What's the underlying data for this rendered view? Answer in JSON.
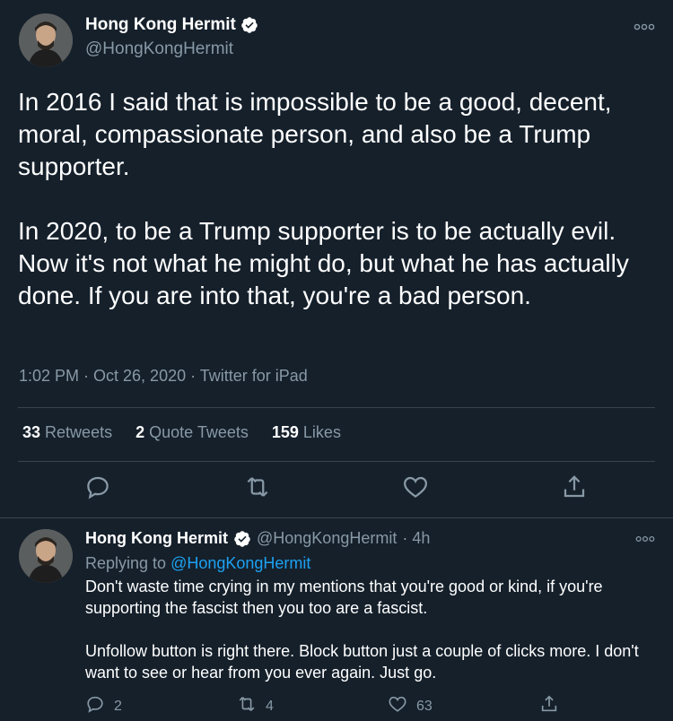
{
  "main_tweet": {
    "display_name": "Hong Kong Hermit",
    "handle": "@HongKongHermit",
    "text": "In 2016 I said that is impossible to be a good, decent, moral, compassionate person, and also be a Trump supporter.\n\nIn 2020, to be a Trump supporter is to be actually evil. Now it's not what he might do, but what he has actually done. If you are into that, you're a bad person.",
    "meta": "1:02 PM · Oct 26, 2020 · Twitter for iPad",
    "stats": {
      "retweets_count": "33",
      "retweets_label": "Retweets",
      "quotes_count": "2",
      "quotes_label": "Quote Tweets",
      "likes_count": "159",
      "likes_label": "Likes"
    }
  },
  "reply_tweet": {
    "display_name": "Hong Kong Hermit",
    "handle": "@HongKongHermit",
    "time": "· 4h",
    "replying_prefix": "Replying to",
    "replying_to": "@HongKongHermit",
    "text": "Don't waste time crying in my mentions that you're good or kind, if you're supporting the fascist then you too are a fascist.\n\nUnfollow button is right there. Block button just a couple of clicks more. I don't want to see or hear from you ever again. Just go.",
    "reply_count": "2",
    "retweet_count": "4",
    "like_count": "63"
  },
  "colors": {
    "background": "#15202b",
    "text": "#ffffff",
    "muted": "#8899a6",
    "link": "#1da1f2",
    "divider": "#38444d",
    "verified": "#ffffff"
  },
  "icons": [
    "verified-icon",
    "more-icon",
    "reply-icon",
    "retweet-icon",
    "like-icon",
    "share-icon"
  ]
}
